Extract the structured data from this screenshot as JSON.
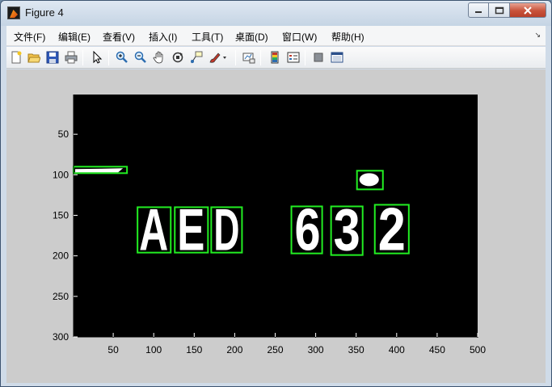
{
  "window": {
    "title": "Figure 4"
  },
  "menu": [
    {
      "label": "文件(F)"
    },
    {
      "label": "编辑(E)"
    },
    {
      "label": "查看(V)"
    },
    {
      "label": "插入(I)"
    },
    {
      "label": "工具(T)"
    },
    {
      "label": "桌面(D)"
    },
    {
      "label": "窗口(W)"
    },
    {
      "label": "帮助(H)"
    }
  ],
  "toolbar": [
    {
      "icon": "new-figure-icon"
    },
    {
      "icon": "open-file-icon"
    },
    {
      "icon": "save-icon"
    },
    {
      "icon": "print-icon"
    },
    {
      "icon": "edit-plot-arrow-icon"
    },
    {
      "icon": "zoom-in-icon"
    },
    {
      "icon": "zoom-out-icon"
    },
    {
      "icon": "pan-hand-icon"
    },
    {
      "icon": "rotate-3d-icon"
    },
    {
      "icon": "data-cursor-icon"
    },
    {
      "icon": "brush-icon"
    },
    {
      "icon": "link-plot-icon"
    },
    {
      "icon": "colorbar-icon"
    },
    {
      "icon": "legend-icon"
    },
    {
      "icon": "hide-plot-tools-icon"
    },
    {
      "icon": "show-plot-tools-icon"
    }
  ],
  "chart_data": {
    "type": "image",
    "description_free": true,
    "xlim": [
      1,
      500
    ],
    "ylim": [
      1,
      300
    ],
    "y_reversed": true,
    "x_ticks": [
      50,
      100,
      150,
      200,
      250,
      300,
      350,
      400,
      450,
      500
    ],
    "y_ticks": [
      50,
      100,
      150,
      200,
      250,
      300
    ],
    "background_color": "#000000",
    "box_color": "#22ee22",
    "glyphs": [
      {
        "text": "A",
        "x": [
          80,
          120
        ],
        "y": [
          140,
          195
        ]
      },
      {
        "text": "E",
        "x": [
          127,
          165
        ],
        "y": [
          140,
          195
        ]
      },
      {
        "text": "D",
        "x": [
          172,
          208
        ],
        "y": [
          140,
          195
        ]
      },
      {
        "text": "6",
        "x": [
          272,
          308
        ],
        "y": [
          140,
          195
        ]
      },
      {
        "text": "3",
        "x": [
          320,
          357
        ],
        "y": [
          140,
          195
        ]
      },
      {
        "text": "2",
        "x": [
          375,
          413
        ],
        "y": [
          138,
          195
        ]
      }
    ],
    "bounding_boxes": [
      {
        "x0": 1,
        "y0": 90,
        "x1": 67,
        "y1": 98
      },
      {
        "x0": 351,
        "y0": 95,
        "x1": 383,
        "y1": 118
      },
      {
        "x0": 80,
        "y0": 140,
        "x1": 121,
        "y1": 196
      },
      {
        "x0": 126,
        "y0": 140,
        "x1": 167,
        "y1": 196
      },
      {
        "x0": 171,
        "y0": 140,
        "x1": 209,
        "y1": 196
      },
      {
        "x0": 270,
        "y0": 139,
        "x1": 308,
        "y1": 197
      },
      {
        "x0": 319,
        "y0": 139,
        "x1": 358,
        "y1": 199
      },
      {
        "x0": 373,
        "y0": 137,
        "x1": 415,
        "y1": 197
      }
    ],
    "blobs": [
      {
        "shape": "bar",
        "x0": 3,
        "y0": 92,
        "x1": 62,
        "y1": 97
      },
      {
        "shape": "blob",
        "cx": 366,
        "cy": 106,
        "rx": 12,
        "ry": 8
      }
    ]
  }
}
